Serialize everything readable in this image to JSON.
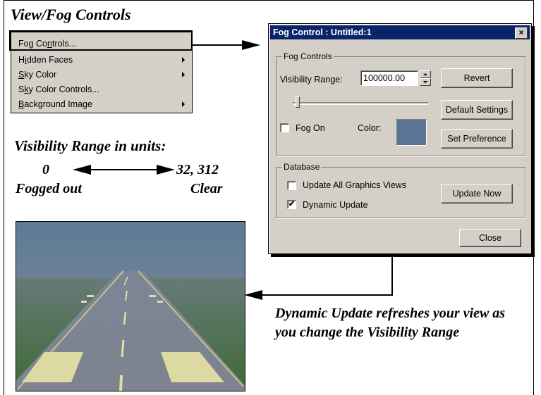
{
  "section_title": "View/Fog Controls",
  "menu": {
    "items": [
      {
        "pre": "Fog Co",
        "ul": "n",
        "post": "trols...",
        "submenu": false
      },
      {
        "pre": "H",
        "ul": "i",
        "post": "dden Faces",
        "submenu": true
      },
      {
        "pre": "",
        "ul": "S",
        "post": "ky Color",
        "submenu": true
      },
      {
        "pre": "S",
        "ul": "k",
        "post": "y Color Controls...",
        "submenu": false
      },
      {
        "pre": "",
        "ul": "B",
        "post": "ackground Image",
        "submenu": true
      }
    ]
  },
  "visibility_range": {
    "title": "Visibility Range in units:",
    "min_value": "0",
    "max_value": "32, 312",
    "min_label": "Fogged out",
    "max_label": "Clear"
  },
  "dialog": {
    "title": "Fog Control : Untitled:1",
    "close_glyph": "×",
    "fog_group_label": "Fog Controls",
    "visibility_label": "Visibility Range:",
    "visibility_value": "100000.00",
    "revert_label": "Revert",
    "default_settings_label": "Default Settings",
    "set_preference_label": "Set Preference",
    "fog_on_label": "Fog On",
    "fog_on_checked": false,
    "color_label": "Color:",
    "fog_color": "#5b7395",
    "slider_position": 0.02,
    "database_group_label": "Database",
    "update_all_label": "Update All Graphics Views",
    "update_all_checked": false,
    "dynamic_update_label": "Dynamic Update",
    "dynamic_update_checked": true,
    "update_now_label": "Update Now",
    "close_label": "Close"
  },
  "caption": "Dynamic Update refreshes your view as you change the Visibility Range"
}
